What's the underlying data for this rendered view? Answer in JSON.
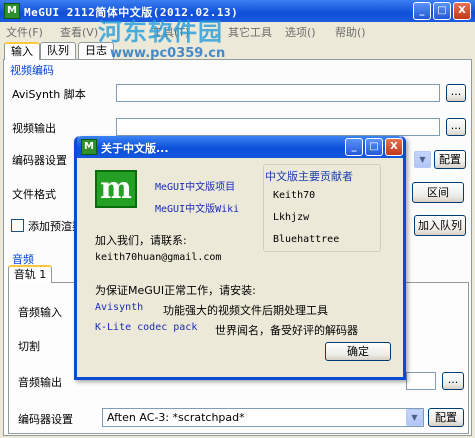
{
  "window": {
    "title": "MeGUI 2112简体中文版(2012.02.13)",
    "icon_text": "M",
    "controls": {
      "minimize": "_",
      "maximize": "□",
      "close": "X"
    }
  },
  "menu": [
    "文件(F)",
    "查看(V)",
    "工具(T)",
    "其它工具",
    "选项()",
    "帮助()"
  ],
  "watermark": {
    "main": "河东软件园",
    "url": "www.pc0359.cn"
  },
  "tabs": [
    "输入",
    "队列",
    "日志"
  ],
  "video": {
    "group_label": "视频编码",
    "avisynth_label": "AviSynth 脚本",
    "output_label": "视频输出",
    "encoder_label": "编码器设置",
    "format_label": "文件格式",
    "preproc_label": "添加预渲染",
    "browse": "...",
    "config_button": "配置",
    "range_button": "区间",
    "add_queue_button": "加入队列"
  },
  "audio": {
    "group_label": "音频",
    "track_tab": "音轨 1",
    "input_label": "音频输入",
    "cut_label": "切割",
    "output_label": "音频输出",
    "encoder_label": "编码器设置",
    "encoder_value": "Aften AC-3: *scratchpad*",
    "config_button": "配置",
    "browse": "..."
  },
  "dialog": {
    "title": "关于中文版...",
    "icon_text": "M",
    "controls": {
      "minimize": "_",
      "maximize": "□",
      "close": "X"
    },
    "logo_text": "m",
    "link_project": "MeGUI中文版项目",
    "link_wiki": "MeGUI中文版Wiki",
    "contributors_title": "中文版主要贡献者",
    "contributors": [
      "Keith70",
      "Lkhjzw",
      "Bluehattree"
    ],
    "join_text": "加入我们，请联系:",
    "email": "keith70huan@gmail.com",
    "requirement": "为保证MeGUI正常工作，请安装:",
    "req1_link": "Avisynth",
    "req1_desc": "功能强大的视频文件后期处理工具",
    "req2_link": "K-Lite codec pack",
    "req2_desc": "世界闻名，备受好评的解码器",
    "ok_button": "确定"
  },
  "colors": {
    "titlebar": "#0f4fd8",
    "link": "#1b2cb8",
    "group": "#0046d5"
  }
}
